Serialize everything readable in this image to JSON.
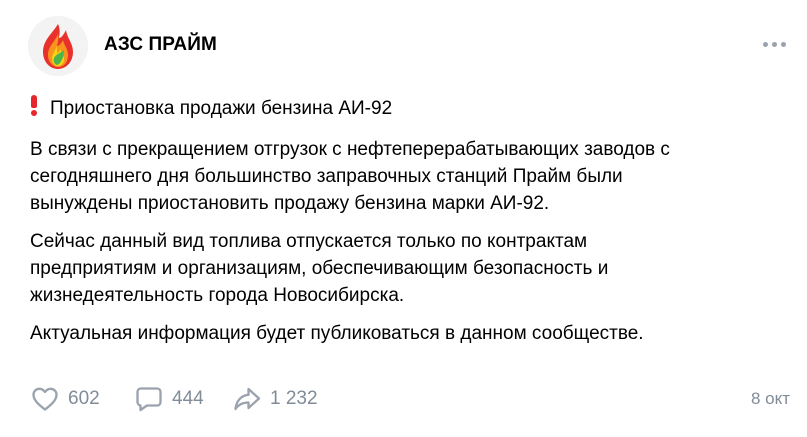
{
  "post": {
    "author": "АЗС ПРАЙМ",
    "avatar_icon": "flame-logo",
    "more_icon": "more-horizontal-icon",
    "headline_icon": "red-exclamation-icon",
    "headline": "Приостановка продажи бензина АИ-92",
    "paragraphs": [
      {
        "lines": [
          "В связи с прекращением отгрузок с нефтеперерабатывающих заводов с",
          "сегодняшнего дня большинство заправочных станций Прайм были",
          "вынуждены приостановить продажу бензина марки АИ-92."
        ]
      },
      {
        "lines": [
          "Сейчас данный вид топлива отпускается только по контрактам",
          "предприятиям и организациям, обеспечивающим безопасность и",
          "жизнедеятельность города Новосибирска."
        ]
      },
      {
        "lines": [
          "Актуальная информация будет публиковаться в данном сообществе."
        ]
      }
    ]
  },
  "footer": {
    "likes": "602",
    "comments": "444",
    "shares": "1 232",
    "date": "8 окт"
  },
  "colors": {
    "muted": "#818c99",
    "icon": "#99a2ad",
    "accent_red": "#e5262d"
  }
}
